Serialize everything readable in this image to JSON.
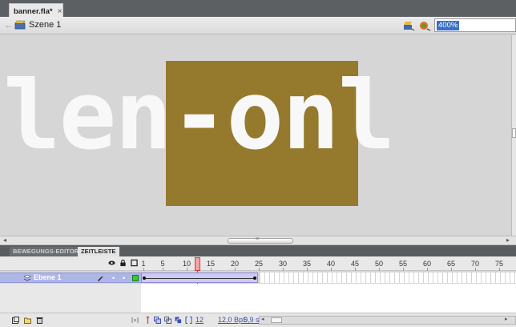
{
  "document_tab": {
    "title": "banner.fla*",
    "close": "×"
  },
  "editbar": {
    "back": "←",
    "scene": "Szene 1",
    "zoom": "400%"
  },
  "stage": {
    "text": "len-onl",
    "box_color": "#957a2e",
    "background": "#d6d6d6"
  },
  "panel_tabs": {
    "motion_editor": "BEWEGUNGS-EDITOR",
    "timeline": "ZEITLEISTE"
  },
  "timeline": {
    "frame_numbers": [
      "1",
      "5",
      "10",
      "15",
      "20",
      "25",
      "30",
      "35",
      "40",
      "45",
      "50",
      "55",
      "60",
      "65",
      "70",
      "75"
    ],
    "current_frame": 12,
    "tween_end_frame": 24,
    "layer": {
      "name": "Ebene 1",
      "vis": "•",
      "lock": "•"
    },
    "status": {
      "frame": "12",
      "fps": "12,0 BpS",
      "time": "0,9 s"
    }
  },
  "icons": {
    "scene": "scene-clapper-icon",
    "edit_symbol": "edit-symbol-icon",
    "edit_scene": "edit-scene-icon",
    "layer": "layer-icon",
    "pencil": "pencil-icon"
  },
  "colors": {
    "selection": "#aeb6e8",
    "playhead": "#d33333",
    "tween": "#ccc9f5",
    "layer_outline": "#33cc33"
  }
}
